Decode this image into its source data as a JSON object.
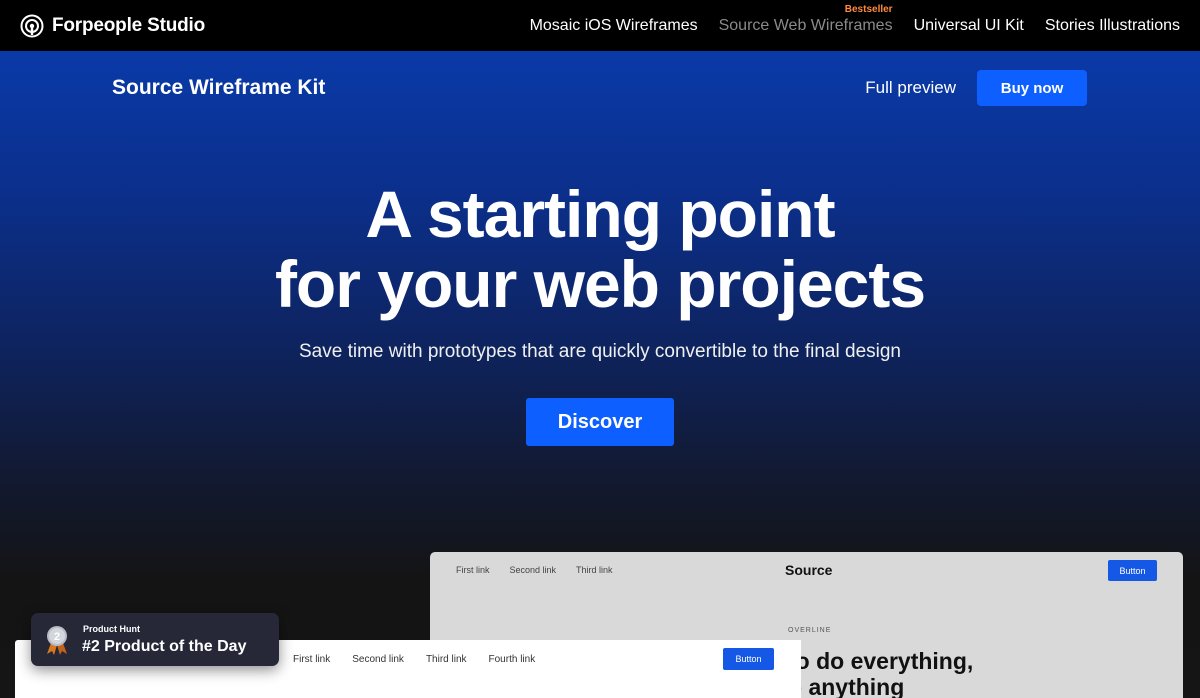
{
  "brand": {
    "name": "Forpeople Studio",
    "logo_icon": "signal-ring-icon"
  },
  "top_nav": {
    "items": [
      {
        "label": "Mosaic iOS Wireframes"
      },
      {
        "label": "Source Web Wireframes",
        "badge": "Bestseller"
      },
      {
        "label": "Universal UI Kit"
      },
      {
        "label": "Stories Illustrations"
      }
    ]
  },
  "subnav": {
    "title": "Source Wireframe Kit",
    "full_preview": "Full preview",
    "buy_now": "Buy now"
  },
  "hero": {
    "headline_line1": "A starting point",
    "headline_line2": "for your web projects",
    "tagline": "Save time with prototypes that are quickly convertible to the final design",
    "cta": "Discover"
  },
  "preview_back": {
    "links": [
      "First link",
      "Second link",
      "Third link"
    ],
    "logo": "Source",
    "button": "Button",
    "overline": "OVERLINE",
    "heading_line1": "to do everything,",
    "heading_line2": "o anything"
  },
  "preview_front": {
    "links": [
      "First link",
      "Second link",
      "Third link",
      "Fourth link"
    ],
    "button": "Button"
  },
  "product_hunt": {
    "label": "Product Hunt",
    "title": "#2 Product of the Day",
    "medal_number": "2",
    "medal_icon": "medal-icon"
  },
  "colors": {
    "accent": "#0d5fff",
    "badge_orange": "#ff8a3c",
    "topbar": "#000000"
  }
}
